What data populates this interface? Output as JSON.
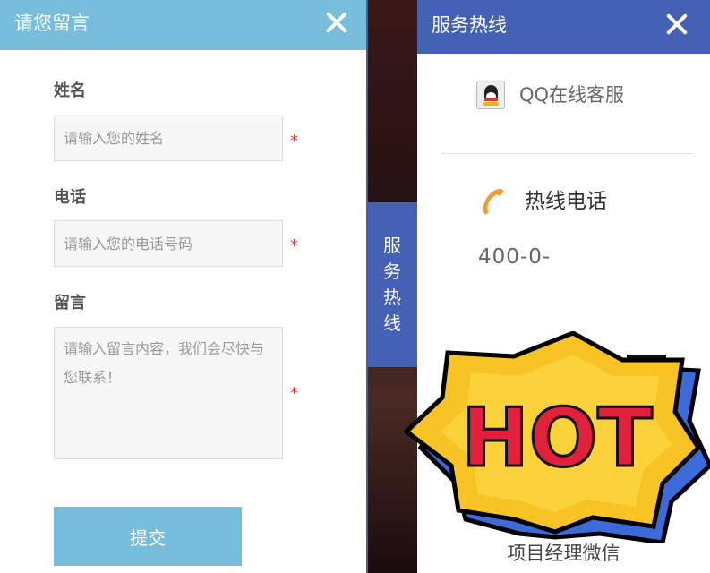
{
  "message_panel": {
    "title": "请您留言",
    "name_label": "姓名",
    "name_placeholder": "请输入您的姓名",
    "phone_label": "电话",
    "phone_placeholder": "请输入您的电话号码",
    "message_label": "留言",
    "message_placeholder": "请输入留言内容，我们会尽快与您联系！",
    "required_mark": "*",
    "submit_label": "提交"
  },
  "side_tab": {
    "chars": [
      "服",
      "务",
      "热",
      "线"
    ]
  },
  "hotline_panel": {
    "title": "服务热线",
    "qq_label": "QQ在线客服",
    "hotline_label": "热线电话",
    "hotline_number": "400-0-",
    "wechat_caption": "项目经理微信"
  },
  "sticker": {
    "text": "HOT"
  },
  "colors": {
    "message_header": "#76bedb",
    "hotline_header": "#4561b3",
    "required": "#e23a3a",
    "phone_icon": "#f09a35",
    "sticker_fill": "#f7c325",
    "sticker_text": "#e0203c",
    "sticker_back": "#3c6bd8"
  },
  "icons": {
    "close": "close-icon",
    "qq": "qq-penguin-icon",
    "phone": "phone-handset-icon"
  }
}
